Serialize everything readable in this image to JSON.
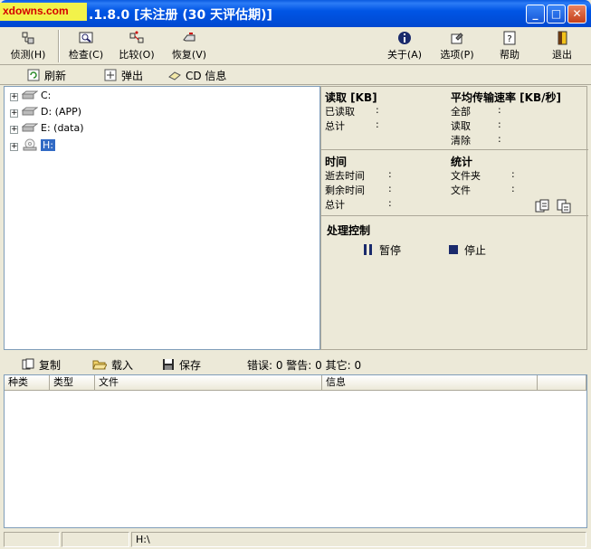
{
  "window": {
    "watermark": "xdowns.com",
    "title": ".1.8.0 [未注册 (30 天评估期)]",
    "min_glyph": "_",
    "max_glyph": "□",
    "close_glyph": "✕"
  },
  "toolbar": {
    "detect": "侦测(H)",
    "check": "检查(C)",
    "compare": "比较(O)",
    "recover": "恢复(V)",
    "about": "关于(A)",
    "options": "选项(P)",
    "help": "帮助",
    "exit": "退出"
  },
  "toolbar2": {
    "refresh": "刷新",
    "eject": "弹出",
    "cdinfo": "CD 信息"
  },
  "tree": {
    "items": [
      {
        "label": "C:"
      },
      {
        "label": "D: (APP)"
      },
      {
        "label": "E: (data)"
      },
      {
        "label": "H:"
      }
    ]
  },
  "info": {
    "read_header": "读取 [KB]",
    "read_done": "已读取",
    "read_total": "总计",
    "speed_header": "平均传输速率 [KB/秒]",
    "speed_all": "全部",
    "speed_read": "读取",
    "speed_clear": "清除",
    "colon": ":",
    "time_header": "时间",
    "elapsed": "逝去时间",
    "remaining": "剩余时间",
    "time_total": "总计",
    "stats_header": "统计",
    "folders": "文件夹",
    "files": "文件",
    "control_header": "处理控制",
    "pause": "暂停",
    "stop": "停止"
  },
  "toolbar3": {
    "copy": "复制",
    "load": "载入",
    "save": "保存",
    "summary": "错误: 0 警告: 0 其它: 0"
  },
  "log": {
    "columns": [
      "种类",
      "类型",
      "文件",
      "信息"
    ]
  },
  "status": {
    "path": "H:\\"
  },
  "colors": {
    "titlebar": "#0055E5",
    "selection": "#316AC5",
    "face": "#ECE9D8"
  }
}
